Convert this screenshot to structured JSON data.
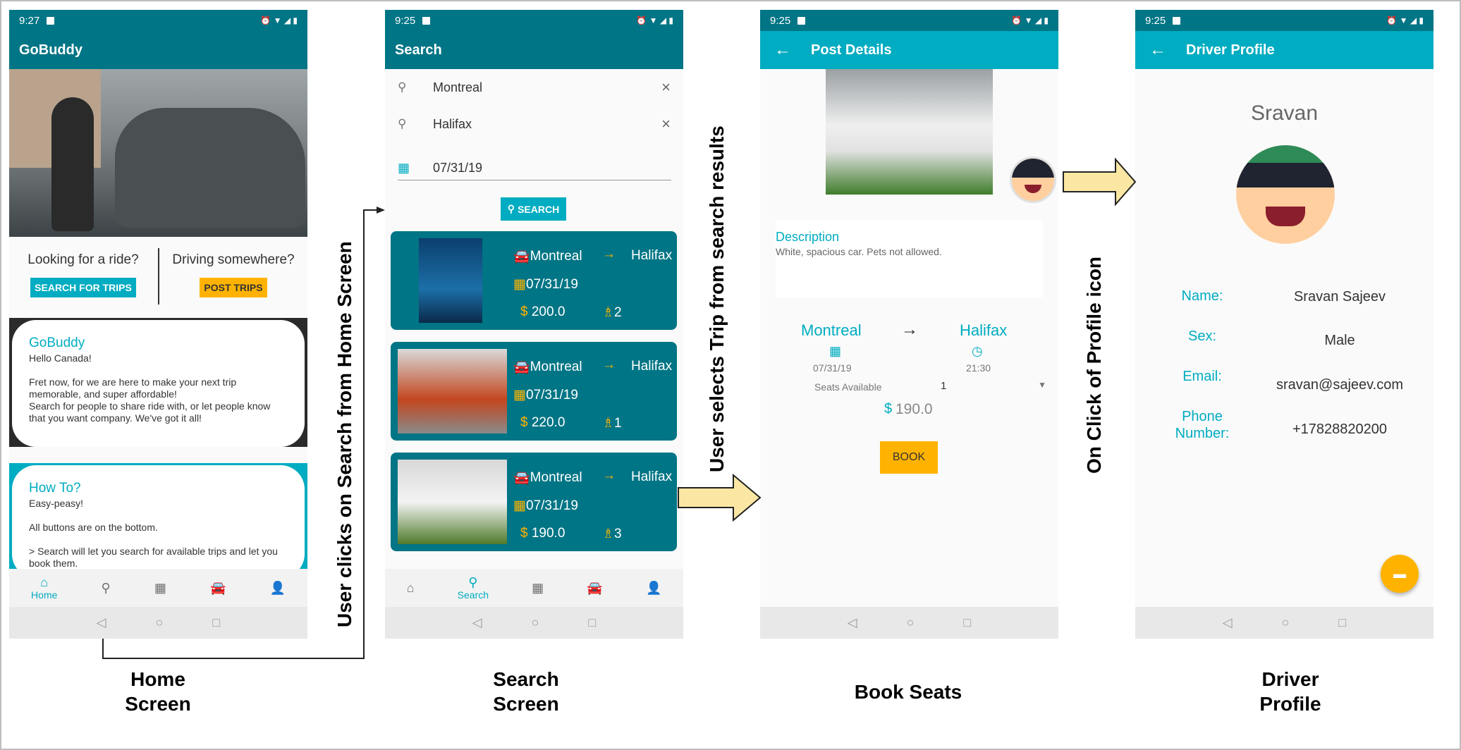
{
  "screens": {
    "home": {
      "status_time": "9:27",
      "title": "GoBuddy",
      "ride_prompt": "Looking for a ride?",
      "search_button": "SEARCH FOR TRIPS",
      "drive_prompt": "Driving somewhere?",
      "post_button": "POST TRIPS",
      "card1_title": "GoBuddy",
      "card1_line1": "Hello Canada!",
      "card1_line2": "Fret now, for we are here to make your next trip memorable, and super affordable!",
      "card1_line3": "Search for people to share ride with, or let people know that you want company. We've got it all!",
      "card2_title": "How To?",
      "card2_line1": "Easy-peasy!",
      "card2_line2": "All buttons are on the bottom.",
      "card2_line3": "> Search will let you search for available trips and let you book them.",
      "nav_home": "Home"
    },
    "search": {
      "status_time": "9:25",
      "title": "Search",
      "from": "Montreal",
      "to": "Halifax",
      "date": "07/31/19",
      "search_button": "SEARCH",
      "results": [
        {
          "from": "Montreal",
          "to": "Halifax",
          "date": "07/31/19",
          "price": "200.0",
          "seats": "2"
        },
        {
          "from": "Montreal",
          "to": "Halifax",
          "date": "07/31/19",
          "price": "220.0",
          "seats": "1"
        },
        {
          "from": "Montreal",
          "to": "Halifax",
          "date": "07/31/19",
          "price": "190.0",
          "seats": "3"
        }
      ],
      "nav_search": "Search"
    },
    "post": {
      "status_time": "9:25",
      "title": "Post Details",
      "desc_title": "Description",
      "desc_text": "White, spacious car. Pets not allowed.",
      "from": "Montreal",
      "to": "Halifax",
      "date": "07/31/19",
      "time": "21:30",
      "seats_label": "Seats Available",
      "seats_value": "1",
      "price": "190.0",
      "book_button": "BOOK"
    },
    "profile": {
      "status_time": "9:25",
      "title": "Driver Profile",
      "name_heading": "Sravan",
      "name_label": "Name:",
      "name_value": "Sravan Sajeev",
      "sex_label": "Sex:",
      "sex_value": "Male",
      "email_label": "Email:",
      "email_value": "sravan@sajeev.com",
      "phone_label1": "Phone",
      "phone_label2": "Number:",
      "phone_value": "+17828820200"
    }
  },
  "annotations": {
    "caption_home_1": "Home",
    "caption_home_2": "Screen",
    "caption_search_1": "Search",
    "caption_search_2": "Screen",
    "caption_book": "Book Seats",
    "caption_driver_1": "Driver",
    "caption_driver_2": "Profile",
    "flow_home_to_search": "User clicks on Search from Home Screen",
    "flow_search_to_book": "User selects Trip from search results",
    "flow_book_to_profile": "On Click of Profile icon"
  },
  "colors": {
    "teal_dark": "#007585",
    "teal_light": "#00acc1",
    "amber": "#ffb300",
    "arrow_fill": "#fbe7a3"
  },
  "icons": [
    "search-icon",
    "close-icon",
    "calendar-icon",
    "car-icon",
    "arrow-right-icon",
    "dollar-icon",
    "seat-icon",
    "home-icon",
    "person-icon",
    "back-arrow-icon",
    "clock-icon",
    "chat-icon"
  ]
}
